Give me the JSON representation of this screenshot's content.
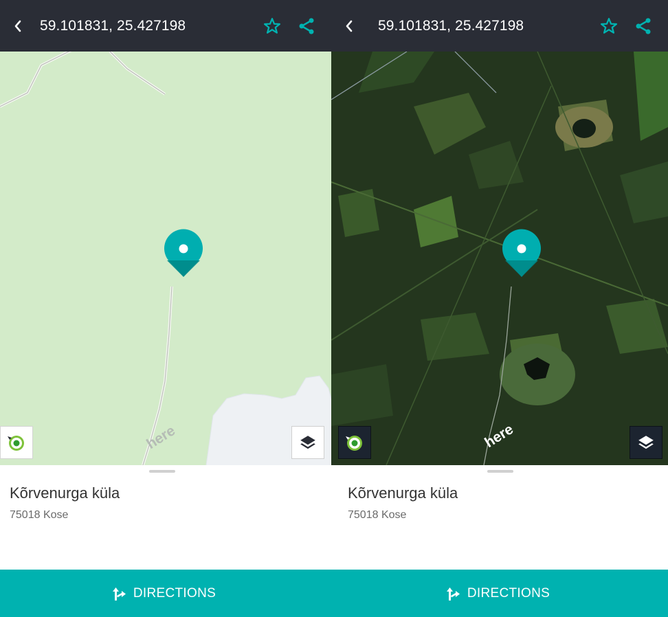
{
  "screens": [
    {
      "map_style": "normal",
      "header": {
        "coordinates": "59.101831, 25.427198",
        "back_icon": "chevron-left-icon",
        "favorite_icon": "star-outline-icon",
        "share_icon": "share-icon"
      },
      "map": {
        "watermark": "here",
        "layers_icon": "layers-icon",
        "locate_icon": "locate-me-icon"
      },
      "place": {
        "name": "Kõrvenurga küla",
        "address": "75018 Kose"
      },
      "action": {
        "label": "DIRECTIONS",
        "icon": "directions-icon"
      }
    },
    {
      "map_style": "satellite",
      "header": {
        "coordinates": "59.101831, 25.427198",
        "back_icon": "chevron-left-icon",
        "favorite_icon": "star-outline-icon",
        "share_icon": "share-icon"
      },
      "map": {
        "watermark": "here",
        "layers_icon": "layers-icon",
        "locate_icon": "locate-me-icon"
      },
      "place": {
        "name": "Kõrvenurga küla",
        "address": "75018 Kose"
      },
      "action": {
        "label": "DIRECTIONS",
        "icon": "directions-icon"
      }
    }
  ],
  "colors": {
    "topbar": "#2a2d36",
    "accent": "#00b2b0",
    "map_normal": "#d3ebc9",
    "map_water": "#eef1f4",
    "satellite_forest": "#24361e"
  }
}
